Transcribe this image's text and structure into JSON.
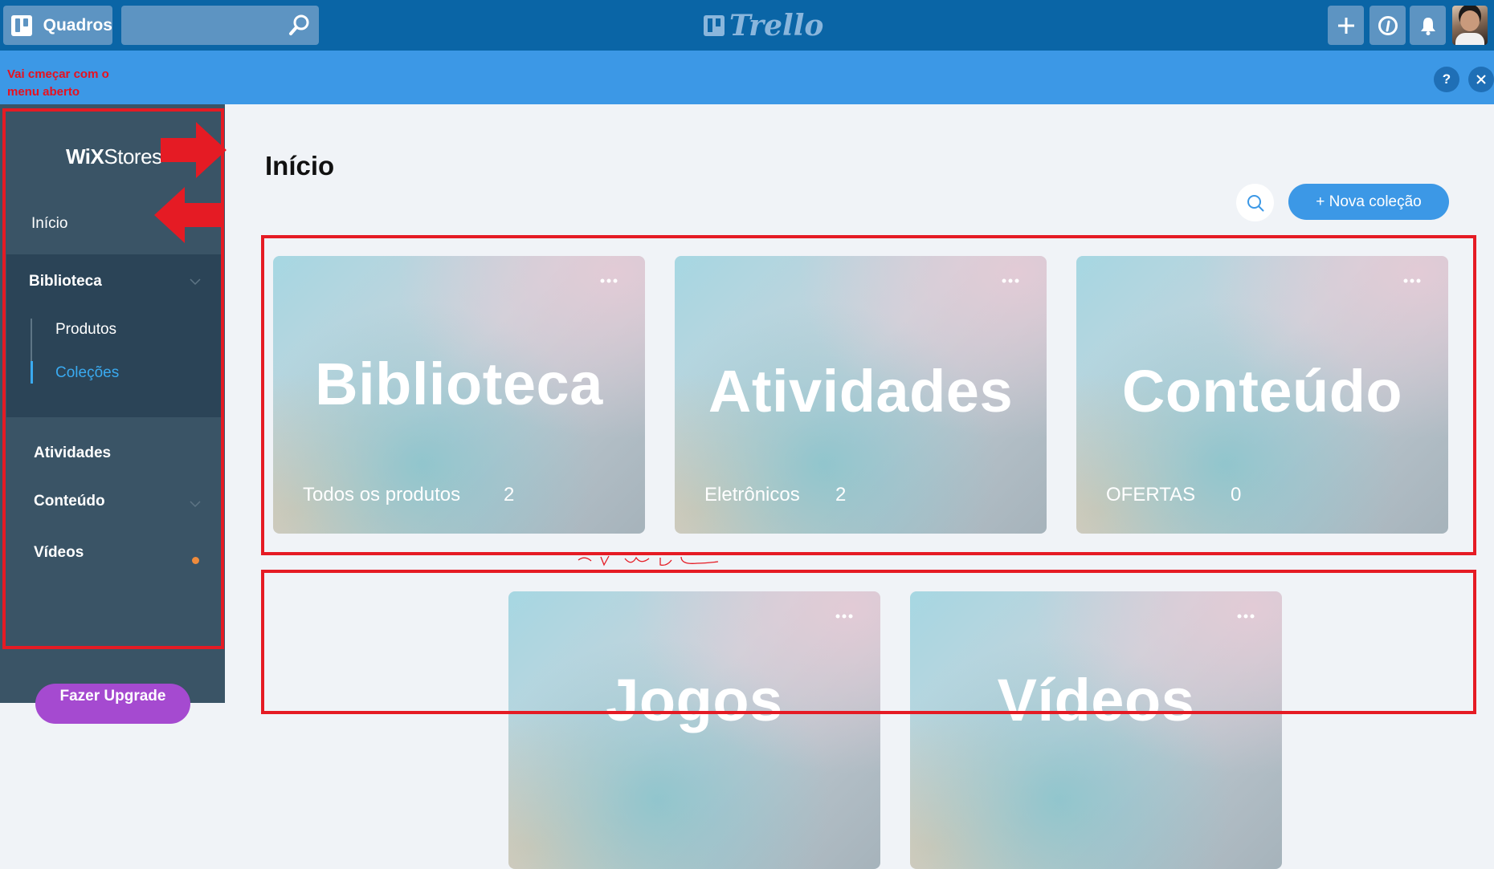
{
  "topbar": {
    "boards_label": "Quadros",
    "search_value": "",
    "logo_text": "Trello",
    "icons": [
      "boards-icon",
      "search-icon",
      "plus-icon",
      "info-icon",
      "bell-icon"
    ]
  },
  "infobar": {
    "annotation": "Vai cmeçar com o menu aberto",
    "help_label": "?",
    "close_label": "×"
  },
  "sidebar": {
    "brand_wix": "WiX",
    "brand_stores": "Stores",
    "home": "Início",
    "library": "Biblioteca",
    "library_items": [
      "Produtos",
      "Coleções"
    ],
    "activities": "Atividades",
    "content": "Conteúdo",
    "videos": "Vídeos",
    "upgrade": "Fazer Upgrade"
  },
  "main": {
    "title": "Início",
    "new_collection": "+ Nova coleção",
    "cards_row1": [
      {
        "title": "Biblioteca",
        "sub": "Todos os produtos",
        "count": "2"
      },
      {
        "title": "Atividades",
        "sub": "Eletrônicos",
        "count": "2"
      },
      {
        "title": "Conteúdo",
        "sub": "OFERTAS",
        "count": "0"
      }
    ],
    "cards_row2": [
      {
        "title": "Jogos"
      },
      {
        "title": "Vídeos"
      }
    ]
  },
  "colors": {
    "topbar": "#0a65a6",
    "infobar": "#3c98e6",
    "sidebar": "#3a5466",
    "accent_blue": "#3c98e6",
    "active_link": "#3aaaf0",
    "annotation_red": "#e51b24",
    "upgrade_purple": "#a54ad0"
  }
}
